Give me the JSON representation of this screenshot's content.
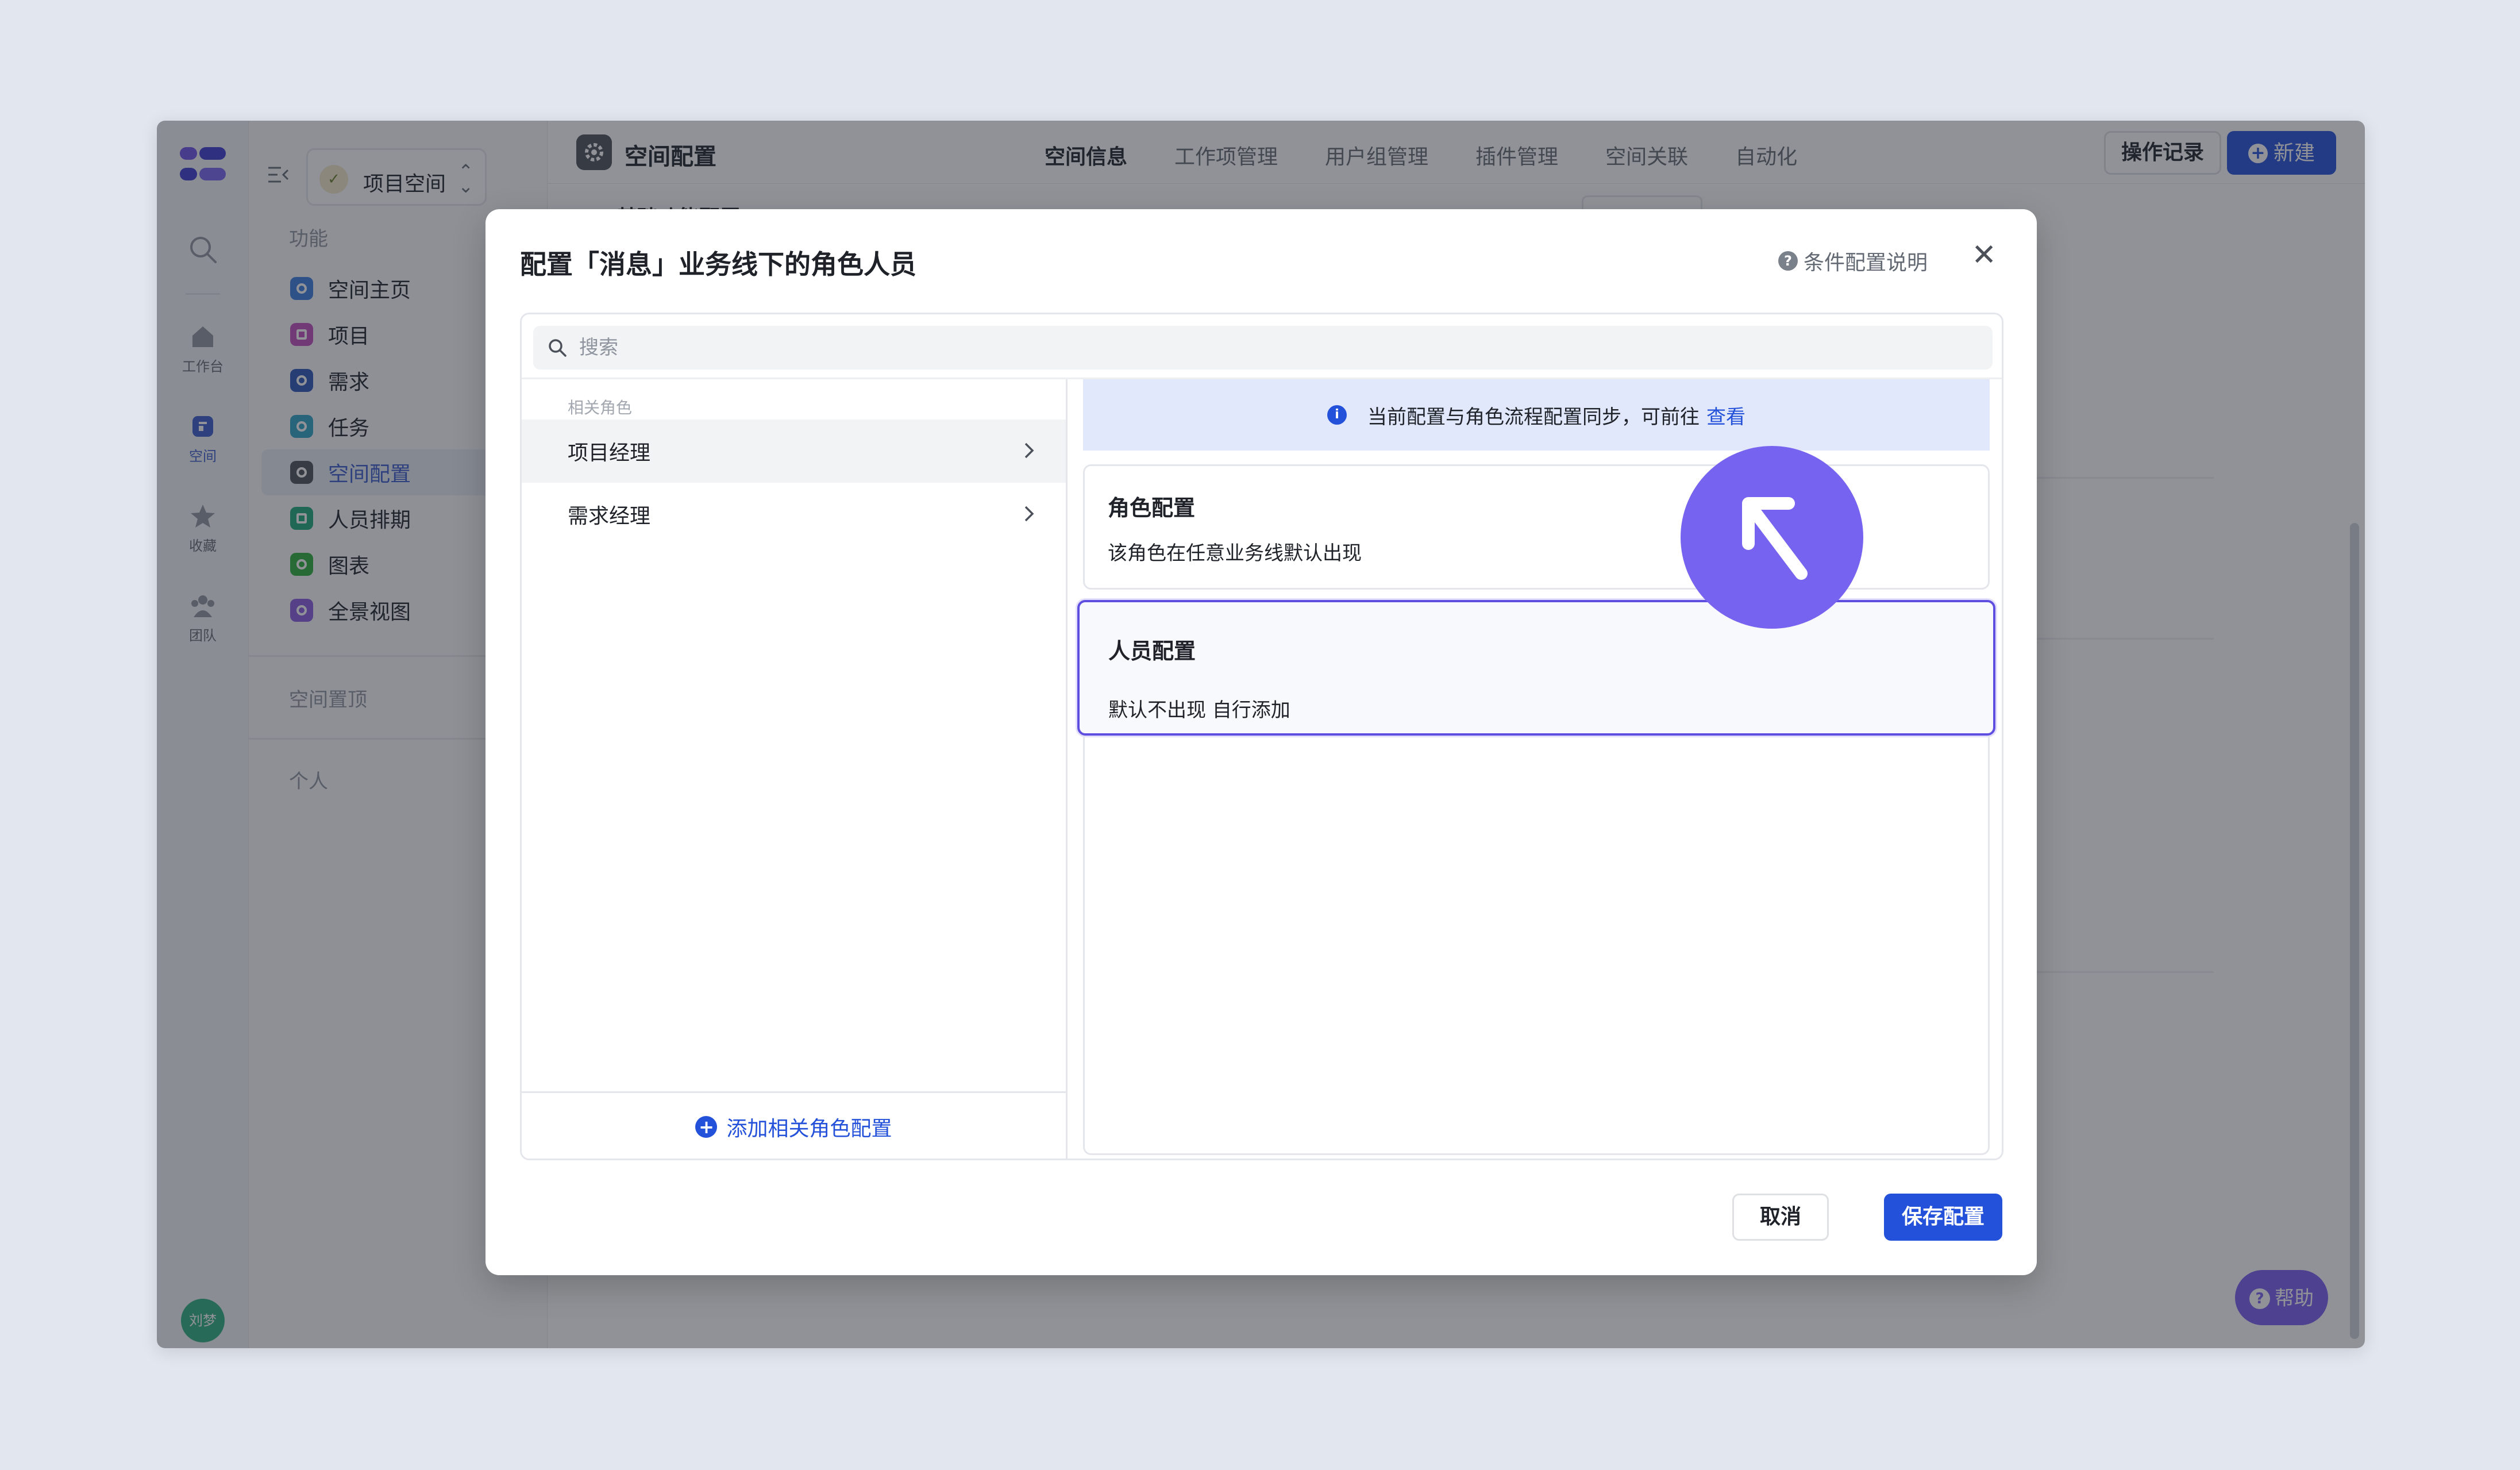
{
  "rail": {
    "items": [
      {
        "label": "工作台",
        "icon": "home-icon"
      },
      {
        "label": "空间",
        "icon": "space-icon"
      },
      {
        "label": "收藏",
        "icon": "star-icon"
      },
      {
        "label": "团队",
        "icon": "team-icon"
      }
    ],
    "avatar": "刘梦"
  },
  "sidebar": {
    "space_name": "项目空间",
    "group_features": "功能",
    "items": [
      {
        "label": "空间主页",
        "color": "#3a7ee0"
      },
      {
        "label": "项目",
        "color": "#c24dbf"
      },
      {
        "label": "需求",
        "color": "#2c56b8"
      },
      {
        "label": "任务",
        "color": "#2fa4c6"
      },
      {
        "label": "空间配置",
        "color": "#4b5059"
      },
      {
        "label": "人员排期",
        "color": "#1fa87a"
      },
      {
        "label": "图表",
        "color": "#2fae3a"
      },
      {
        "label": "全景视图",
        "color": "#8a5ce0"
      }
    ],
    "group_pinned": "空间置顶",
    "group_personal": "个人"
  },
  "topbar": {
    "title": "空间配置",
    "tabs": [
      "空间信息",
      "工作项管理",
      "用户组管理",
      "插件管理",
      "空间关联",
      "自动化"
    ],
    "log_button": "操作记录",
    "new_button": "新建",
    "peek_heading": "基础功能配置"
  },
  "help_button": "帮助",
  "modal": {
    "title": "配置「消息」业务线下的角色人员",
    "help_link": "条件配置说明",
    "search_placeholder": "搜索",
    "roles_heading": "相关角色",
    "roles": [
      "项目经理",
      "需求经理"
    ],
    "add_role": "添加相关角色配置",
    "notice_text": "当前配置与角色流程配置同步，可前往",
    "notice_link": "查看",
    "cards": [
      {
        "title": "角色配置",
        "desc": "该角色在任意业务线默认出现"
      },
      {
        "title": "人员配置",
        "desc": "默认不出现 自行添加"
      }
    ],
    "cancel": "取消",
    "save": "保存配置"
  },
  "colors": {
    "primary": "#2451d9",
    "selected_border": "#5f4fe0",
    "cursor_circle": "#7664f0"
  }
}
